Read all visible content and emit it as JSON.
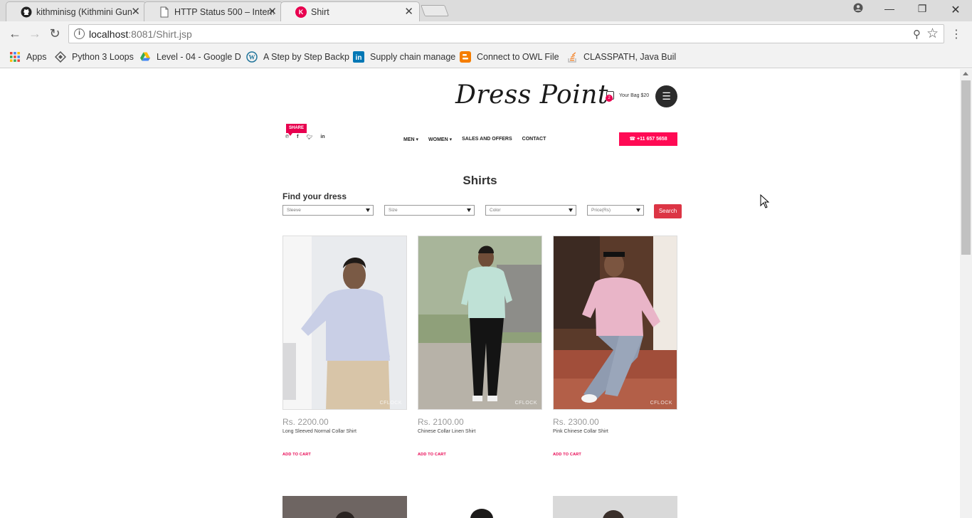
{
  "browser": {
    "tabs": [
      {
        "title": "kithminisg (Kithmini Gun",
        "icon": "github-icon"
      },
      {
        "title": "HTTP Status 500 – Interna",
        "icon": "document-icon"
      },
      {
        "title": "Shirt",
        "icon": "k-favicon",
        "favicon_letter": "K",
        "active": true
      }
    ],
    "url_host": "localhost",
    "url_rest": ":8081/Shirt.jsp",
    "bookmarks": [
      {
        "label": "Apps",
        "icon": "apps-grid-icon"
      },
      {
        "label": "Python 3 Loops",
        "icon": "diamond-icon"
      },
      {
        "label": "Level - 04 - Google D",
        "icon": "google-drive-icon"
      },
      {
        "label": "A Step by Step Backp",
        "icon": "wordpress-icon"
      },
      {
        "label": "Supply chain manage",
        "icon": "linkedin-icon"
      },
      {
        "label": "Connect to OWL File",
        "icon": "blogger-icon"
      },
      {
        "label": "CLASSPATH, Java Buil",
        "icon": "stackoverflow-icon"
      }
    ]
  },
  "site": {
    "logo": "Dress Point",
    "bag_count": "2",
    "bag_label": "Your Bag $20",
    "share_label": "SHARE",
    "social": [
      "pinterest-icon",
      "facebook-icon",
      "twitter-icon",
      "linkedin-icon"
    ],
    "nav": [
      {
        "label": "MEN",
        "dropdown": true
      },
      {
        "label": "WOMEN",
        "dropdown": true
      },
      {
        "label": "SALES AND OFFERS",
        "dropdown": false
      },
      {
        "label": "CONTACT",
        "dropdown": false
      }
    ],
    "phone": "+11 657 5658",
    "accent_color": "#ff0a54"
  },
  "page": {
    "heading": "Shirts",
    "filter_title": "Find your dress",
    "filters": {
      "sleeve": "Sleeve",
      "size": "Size",
      "color": "Color",
      "price": "Price(Rs)"
    },
    "search_label": "Search"
  },
  "products": [
    {
      "price": "Rs. 2200.00",
      "name": "Long Sleeved Normal Collar Shirt",
      "cart": "ADD TO CART",
      "watermark": "CFLOCK"
    },
    {
      "price": "Rs. 2100.00",
      "name": "Chinese Collar Linen Shirt",
      "cart": "ADD TO CART",
      "watermark": "CFLOCK"
    },
    {
      "price": "Rs. 2300.00",
      "name": "Pink Chinese Collar Shirt",
      "cart": "ADD TO CART",
      "watermark": "CFLOCK"
    }
  ]
}
